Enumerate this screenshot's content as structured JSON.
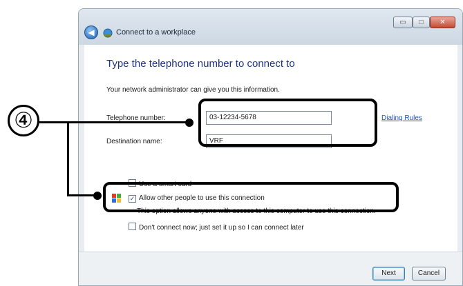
{
  "window": {
    "title": "Connect to a workplace",
    "controls": {
      "minimize": "▭",
      "maximize": "□",
      "close": "✕"
    }
  },
  "content": {
    "heading": "Type the telephone number to connect to",
    "info": "Your network administrator can give you this information.",
    "phone_label": "Telephone number:",
    "phone_value": "03-12234-5678",
    "dest_label": "Destination name:",
    "dest_value": "VRF",
    "dialing_rules": "Dialing Rules",
    "smart_card": {
      "label": "Use a smart card",
      "checked": false
    },
    "allow_others": {
      "label": "Allow other people to use this connection",
      "checked": true,
      "description": "This option allows anyone with access to this computer to use this connection."
    },
    "dont_connect": {
      "label": "Don't connect now; just set it up so I can connect later",
      "checked": false
    }
  },
  "footer": {
    "next": "Next",
    "cancel": "Cancel"
  },
  "callout": {
    "number": "④",
    "color": "#000000"
  },
  "colors": {
    "heading": "#1e3287",
    "link": "#1b53c2",
    "chrome": "#e9edf1"
  }
}
